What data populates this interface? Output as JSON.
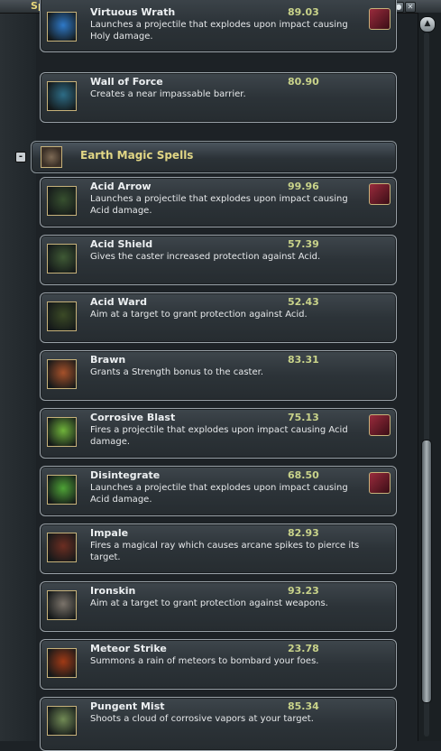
{
  "window": {
    "title": "Spells"
  },
  "window_buttons": [
    "resize-icon",
    "settings-icon",
    "close-icon"
  ],
  "group": {
    "label": "Earth Magic Spells",
    "toggle": "-"
  },
  "spells": [
    {
      "name": "Virtuous Wrath",
      "value": "89.03",
      "desc": "Launches a projectile that explodes upon impact causing Holy damage.",
      "icon": "holy-burst-icon",
      "color": "#2e79c8",
      "wand": true
    },
    {
      "name": "Wall of Force",
      "value": "80.90",
      "desc": "Creates a near impassable barrier.",
      "icon": "barrier-icon",
      "color": "#2d6c86",
      "wand": false
    },
    {
      "name": "Acid Arrow",
      "value": "99.96",
      "desc": "Launches a projectile that explodes upon impact causing Acid damage.",
      "icon": "acid-arrow-icon",
      "color": "#37502f",
      "wand": true
    },
    {
      "name": "Acid Shield",
      "value": "57.39",
      "desc": "Gives the caster increased protection against Acid.",
      "icon": "acid-shield-icon",
      "color": "#3f5a35",
      "wand": false
    },
    {
      "name": "Acid Ward",
      "value": "52.43",
      "desc": "Aim at a target to grant protection against Acid.",
      "icon": "acid-ward-icon",
      "color": "#3b4a26",
      "wand": false
    },
    {
      "name": "Brawn",
      "value": "83.31",
      "desc": "Grants a Strength bonus to the caster.",
      "icon": "strength-arm-icon",
      "color": "#a6512a",
      "wand": false
    },
    {
      "name": "Corrosive Blast",
      "value": "75.13",
      "desc": "Fires a projectile that explodes upon impact causing Acid damage.",
      "icon": "corrosive-blast-icon",
      "color": "#6fb33a",
      "wand": true
    },
    {
      "name": "Disintegrate",
      "value": "68.50",
      "desc": "Launches a projectile that explodes upon impact causing Acid damage.",
      "icon": "disintegrate-icon",
      "color": "#4ea336",
      "wand": true
    },
    {
      "name": "Impale",
      "value": "82.93",
      "desc": "Fires a magical ray which causes arcane spikes to pierce its target.",
      "icon": "impale-spike-icon",
      "color": "#6c2e22",
      "wand": false
    },
    {
      "name": "Ironskin",
      "value": "93.23",
      "desc": "Aim at a target to grant protection against weapons.",
      "icon": "ironskin-hand-icon",
      "color": "#7b736a",
      "wand": false
    },
    {
      "name": "Meteor Strike",
      "value": "23.78",
      "desc": "Summons a rain of meteors to bombard your foes.",
      "icon": "meteor-icon",
      "color": "#a03a16",
      "wand": false
    },
    {
      "name": "Pungent Mist",
      "value": "85.34",
      "desc": "Shoots a cloud of corrosive vapors at your target.",
      "icon": "mist-cloud-icon",
      "color": "#718a55",
      "wand": false
    }
  ],
  "wand_icon": "wand-equip-icon",
  "scrollbar": {
    "up_arrow": "▲"
  }
}
